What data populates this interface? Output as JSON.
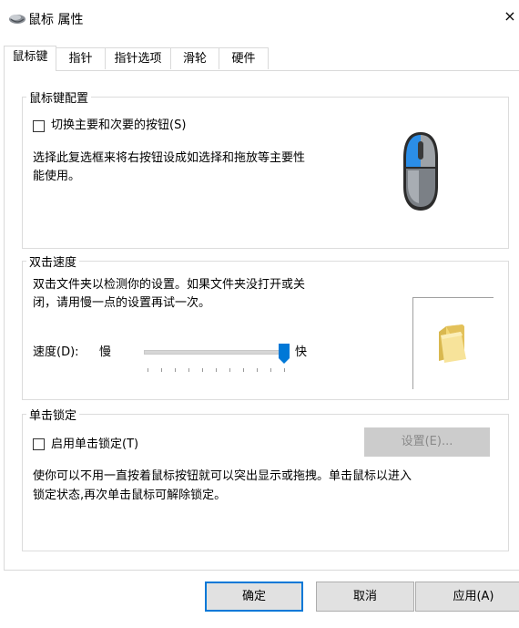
{
  "window": {
    "title": "鼠标 属性",
    "close_glyph": "×"
  },
  "tabs": [
    {
      "label": "鼠标键"
    },
    {
      "label": "指针"
    },
    {
      "label": "指针选项"
    },
    {
      "label": "滑轮"
    },
    {
      "label": "硬件"
    }
  ],
  "button_config": {
    "title": "鼠标键配置",
    "switch_label": "切换主要和次要的按钮(S)",
    "description_line1": "选择此复选框来将右按钮设成如选择和拖放等主要性",
    "description_line2": "能使用。",
    "mouse_icon": "mouse-icon"
  },
  "double_click": {
    "title": "双击速度",
    "description_line1": "双击文件夹以检测你的设置。如果文件夹没打开或关",
    "description_line2": "闭，请用慢一点的设置再试一次。",
    "speed_label": "速度(D):",
    "slow_label": "慢",
    "fast_label": "快",
    "speed_value": 1.0,
    "folder_icon": "folder-icon"
  },
  "click_lock": {
    "title": "单击锁定",
    "enable_label": "启用单击锁定(T)",
    "settings_label": "设置(E)...",
    "description_line1": "使你可以不用一直按着鼠标按钮就可以突出显示或拖拽。单击鼠标以进入",
    "description_line2": "锁定状态,再次单击鼠标可解除锁定。"
  },
  "footer": {
    "ok_label": "确定",
    "cancel_label": "取消",
    "apply_label": "应用(A)"
  },
  "colors": {
    "accent": "#0078d7",
    "disabled_button": "#cccccc"
  }
}
